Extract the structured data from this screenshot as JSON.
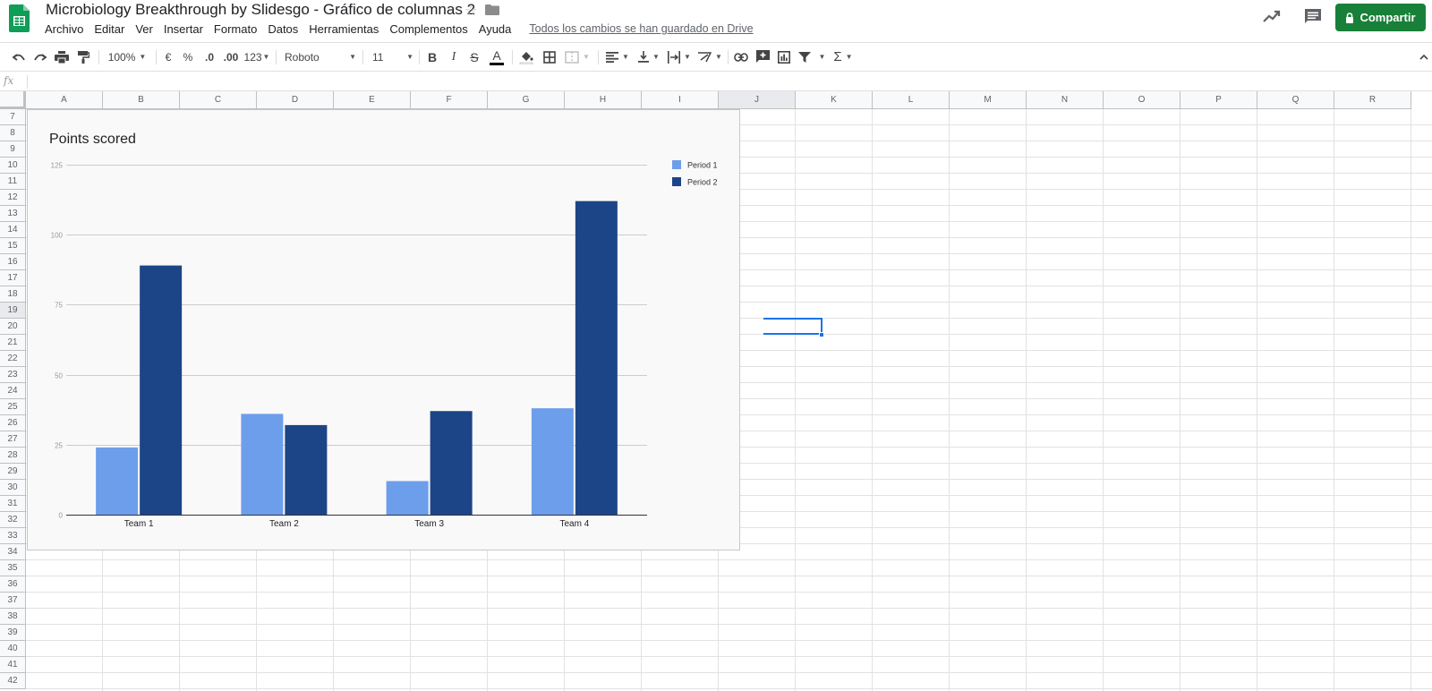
{
  "app": {
    "doc_title": "Microbiology Breakthrough by Slidesgo - Gráfico de columnas 2",
    "save_status": "Todos los cambios se han guardado en Drive",
    "share_label": "Compartir",
    "icons": [
      "sheets-logo-icon",
      "star-icon",
      "folder-icon",
      "trend-icon",
      "comment-icon",
      "lock-icon"
    ],
    "brand_color": "#188038"
  },
  "menus": [
    "Archivo",
    "Editar",
    "Ver",
    "Insertar",
    "Formato",
    "Datos",
    "Herramientas",
    "Complementos",
    "Ayuda"
  ],
  "toolbar": {
    "zoom": "100%",
    "currency": "€",
    "percent": "%",
    "decrease_decimals": ".0",
    "increase_decimals": ".00",
    "more_formats": "123",
    "font": "Roboto",
    "font_size": "11",
    "bold": "B",
    "italic": "I",
    "strike": "S",
    "text_color": "A",
    "function": "Σ"
  },
  "formula_bar": {
    "fx": "fx"
  },
  "grid": {
    "columns": [
      "A",
      "B",
      "C",
      "D",
      "E",
      "F",
      "G",
      "H",
      "I",
      "J",
      "K",
      "L",
      "M",
      "N",
      "O",
      "P",
      "Q",
      "R"
    ],
    "rows": [
      "7",
      "8",
      "9",
      "10",
      "11",
      "12",
      "13",
      "14",
      "15",
      "16",
      "17",
      "18",
      "19",
      "20",
      "21",
      "22",
      "23",
      "24",
      "25",
      "26",
      "27",
      "28",
      "29",
      "30",
      "31",
      "32",
      "33",
      "34",
      "35",
      "36",
      "37",
      "38",
      "39",
      "40",
      "41",
      "42"
    ],
    "selected_column": "J",
    "selected_row": "19"
  },
  "chart_data": {
    "type": "bar",
    "title": "Points scored",
    "categories": [
      "Team 1",
      "Team 2",
      "Team 3",
      "Team 4"
    ],
    "series": [
      {
        "name": "Period 1",
        "values": [
          24,
          36,
          12,
          38
        ],
        "color": "#6d9eeb"
      },
      {
        "name": "Period 2",
        "values": [
          89,
          32,
          37,
          112
        ],
        "color": "#1c4587"
      }
    ],
    "ylim": [
      0,
      125
    ],
    "yticks": [
      0,
      25,
      50,
      75,
      100,
      125
    ],
    "grid": true,
    "legend": "right",
    "xlabel": "",
    "ylabel": ""
  }
}
